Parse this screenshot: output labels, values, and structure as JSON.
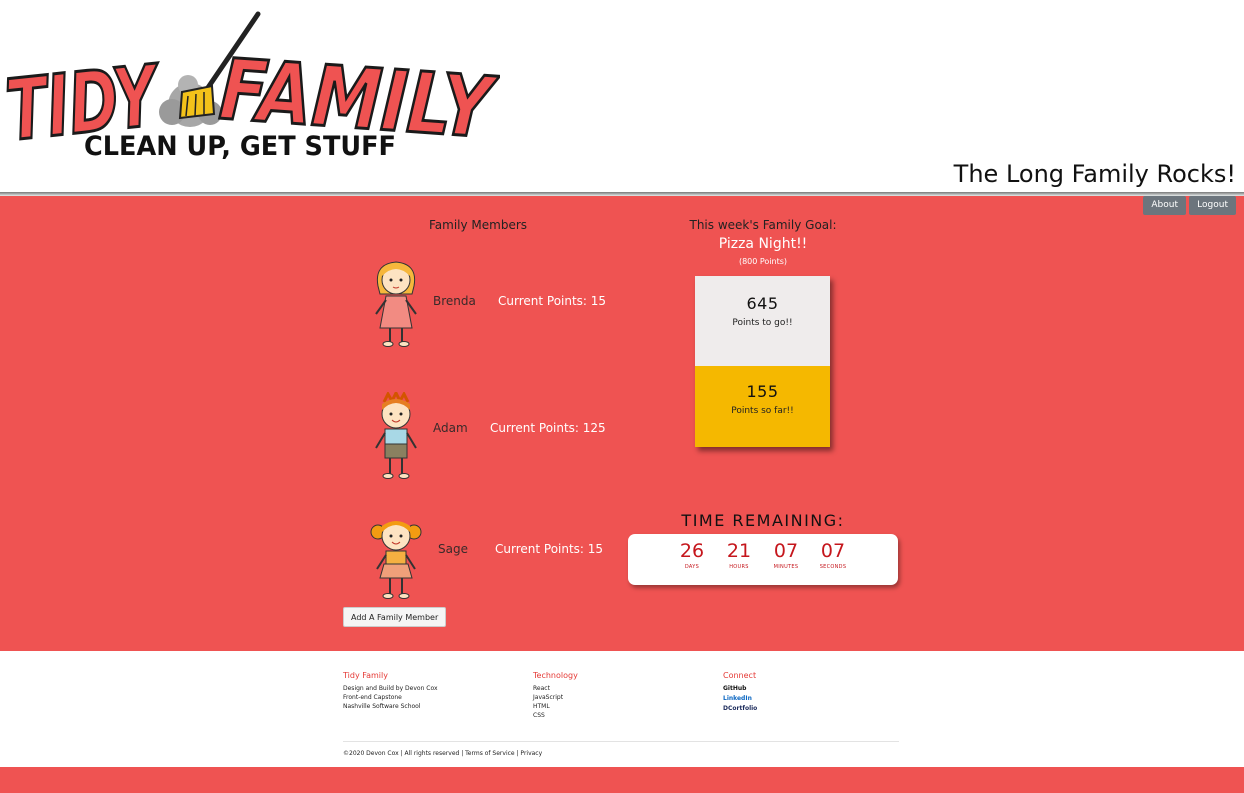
{
  "header": {
    "logo_word1": "TIDY",
    "logo_word2": "FAMILY",
    "logo_tagline": "CLEAN UP, GET STUFF",
    "slogan": "The Long Family Rocks!"
  },
  "nav": {
    "about_label": "About",
    "logout_label": "Logout"
  },
  "members": {
    "title": "Family Members",
    "items": [
      {
        "name": "Brenda",
        "points_label": "Current Points: 15",
        "points": 15
      },
      {
        "name": "Adam",
        "points_label": "Current Points: 125",
        "points": 125
      },
      {
        "name": "Sage",
        "points_label": "Current Points: 15",
        "points": 15
      }
    ],
    "add_button_label": "Add A Family Member"
  },
  "goal": {
    "title": "This week's Family Goal:",
    "name": "Pizza Night!!",
    "points_note": "(800 Points)",
    "to_go_value": "645",
    "to_go_label": "Points to go!!",
    "so_far_value": "155",
    "so_far_label": "Points so far!!"
  },
  "timer": {
    "title": "TIME REMAINING:",
    "units": [
      {
        "value": "26",
        "label": "DAYS"
      },
      {
        "value": "21",
        "label": "HOURS"
      },
      {
        "value": "07",
        "label": "MINUTES"
      },
      {
        "value": "07",
        "label": "SECONDS"
      }
    ]
  },
  "footer": {
    "col1": {
      "heading": "Tidy Family",
      "lines": [
        "Design and Build by Devon Cox",
        "Front-end Capstone",
        "Nashville Software School"
      ]
    },
    "col2": {
      "heading": "Technology",
      "lines": [
        "React",
        "JavaScript",
        "HTML",
        "CSS"
      ]
    },
    "col3": {
      "heading": "Connect",
      "links": [
        "GitHub",
        "LinkedIn",
        "DCortfolio"
      ]
    },
    "copyright": "©2020 Devon Cox | All rights reserved | Terms of Service | Privacy"
  },
  "colors": {
    "brand_red": "#ef5352",
    "goal_gold": "#f5b800",
    "timer_red": "#c5161c"
  }
}
